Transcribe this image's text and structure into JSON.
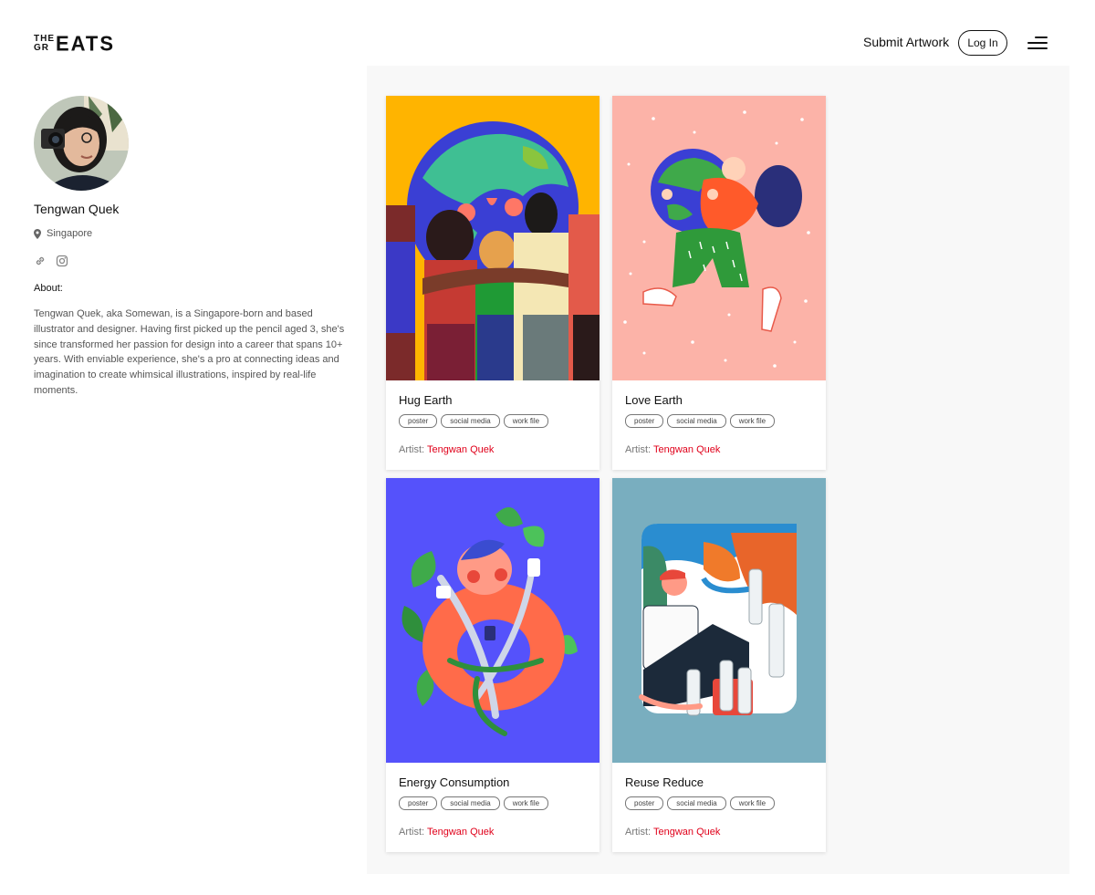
{
  "header": {
    "logo": {
      "top": "THE",
      "middle": "GR",
      "big": "EATS"
    },
    "submit_label": "Submit Artwork",
    "login_label": "Log In",
    "menu_icon": "hamburger-menu-icon"
  },
  "profile": {
    "name": "Tengwan Quek",
    "location": "Singapore",
    "location_icon": "map-pin-icon",
    "social_icons": [
      "link-icon",
      "instagram-icon"
    ],
    "about_label": "About:",
    "about_text": "Tengwan Quek, aka Somewan, is a Singapore-born and based illustrator and designer. Having first picked up the pencil aged 3, she's since transformed her passion for design into a career that spans 10+ years. With enviable experience, she's a pro at connecting ideas and imagination to create whimsical illustrations, inspired by real-life moments."
  },
  "artworks": [
    {
      "title": "Hug Earth",
      "tags": [
        "poster",
        "social media",
        "work file"
      ],
      "artist_label": "Artist:",
      "artist": "Tengwan Quek",
      "bg": "#ffb400"
    },
    {
      "title": "Love Earth",
      "tags": [
        "poster",
        "social media",
        "work file"
      ],
      "artist_label": "Artist:",
      "artist": "Tengwan Quek",
      "bg": "#fcb3a8"
    },
    {
      "title": "Energy Consumption",
      "tags": [
        "poster",
        "social media",
        "work file"
      ],
      "artist_label": "Artist:",
      "artist": "Tengwan Quek",
      "bg": "#5552fb"
    },
    {
      "title": "Reuse Reduce",
      "tags": [
        "poster",
        "social media",
        "work file"
      ],
      "artist_label": "Artist:",
      "artist": "Tengwan Quek",
      "bg": "#79aebf"
    }
  ],
  "colors": {
    "accent": "#e0001a",
    "gallery_bg": "#f8f8f8"
  }
}
